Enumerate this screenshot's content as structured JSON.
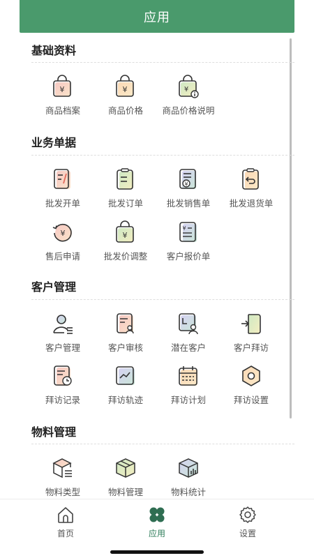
{
  "header": {
    "title": "应用"
  },
  "sections": [
    {
      "title": "基础资料",
      "items": [
        "商品档案",
        "商品价格",
        "商品价格说明"
      ]
    },
    {
      "title": "业务单据",
      "items": [
        "批发开单",
        "批发订单",
        "批发销售单",
        "批发退货单",
        "售后申请",
        "批发价调整",
        "客户报价单"
      ]
    },
    {
      "title": "客户管理",
      "items": [
        "客户管理",
        "客户审核",
        "潜在客户",
        "客户拜访",
        "拜访记录",
        "拜访轨迹",
        "拜访计划",
        "拜访设置"
      ]
    },
    {
      "title": "物料管理",
      "items": [
        "物料类型",
        "物料管理",
        "物料统计"
      ]
    }
  ],
  "tabbar": [
    {
      "label": "首页",
      "icon": "home-icon"
    },
    {
      "label": "应用",
      "icon": "apps-icon"
    },
    {
      "label": "设置",
      "icon": "settings-icon"
    }
  ],
  "colors": {
    "accent": "#4a9a6c",
    "active_tab": "#2f7d5b"
  }
}
